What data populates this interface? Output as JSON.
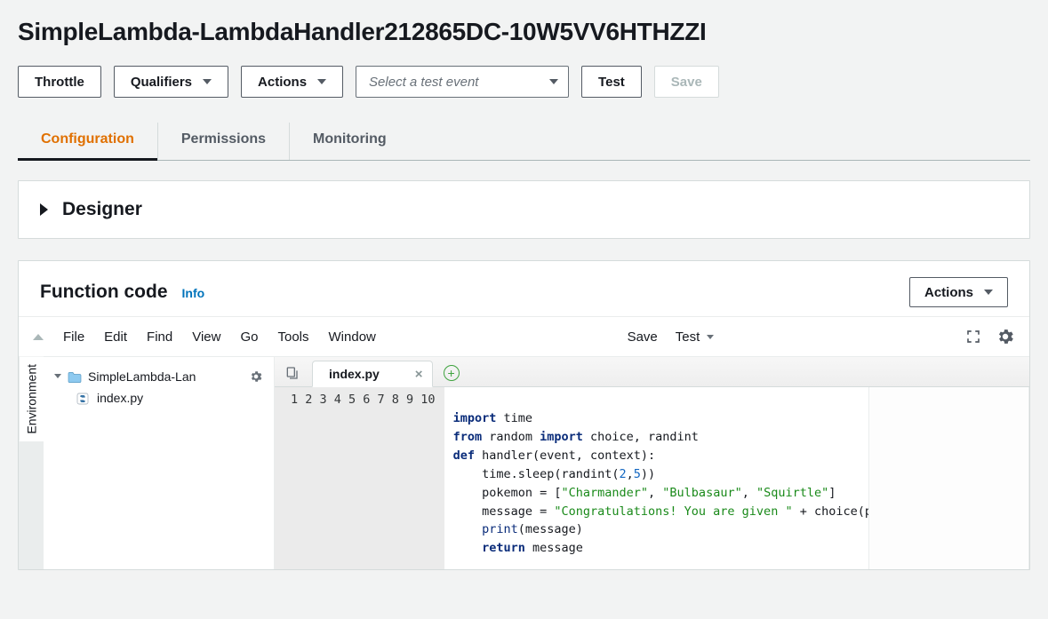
{
  "title": "SimpleLambda-LambdaHandler212865DC-10W5VV6HTHZZI",
  "toolbar": {
    "throttle": "Throttle",
    "qualifiers": "Qualifiers",
    "actions": "Actions",
    "test_placeholder": "Select a test event",
    "test": "Test",
    "save": "Save"
  },
  "tabs": [
    "Configuration",
    "Permissions",
    "Monitoring"
  ],
  "active_tab": 0,
  "designer": {
    "title": "Designer"
  },
  "function_code": {
    "title": "Function code",
    "info": "Info",
    "actions": "Actions"
  },
  "ide": {
    "menubar": [
      "File",
      "Edit",
      "Find",
      "View",
      "Go",
      "Tools",
      "Window"
    ],
    "save": "Save",
    "test": "Test",
    "environment_label": "Environment",
    "tree": {
      "root": "SimpleLambda-Lan",
      "file": "index.py"
    },
    "open_tab": "index.py",
    "line_count": 10,
    "code": {
      "l2": {
        "kw1": "import",
        "rest": " time"
      },
      "l3": {
        "kw1": "from",
        "mid": " random ",
        "kw2": "import",
        "rest": " choice, randint"
      },
      "l4": {
        "kw1": "def",
        "rest": " handler(event, context):"
      },
      "l5": {
        "pre": "    time.sleep(randint(",
        "n1": "2",
        "comma": ",",
        "n2": "5",
        "post": "))"
      },
      "l6": {
        "pre": "    pokemon = [",
        "s1": "\"Charmander\"",
        "c1": ", ",
        "s2": "\"Bulbasaur\"",
        "c2": ", ",
        "s3": "\"Squirtle\"",
        "post": "]"
      },
      "l7": {
        "pre": "    message = ",
        "s1": "\"Congratulations! You are given \"",
        "post": " + choice(pokemon)"
      },
      "l8": {
        "pre": "    ",
        "fn": "print",
        "post": "(message)"
      },
      "l9": {
        "pre": "    ",
        "kw": "return",
        "post": " message"
      }
    }
  }
}
